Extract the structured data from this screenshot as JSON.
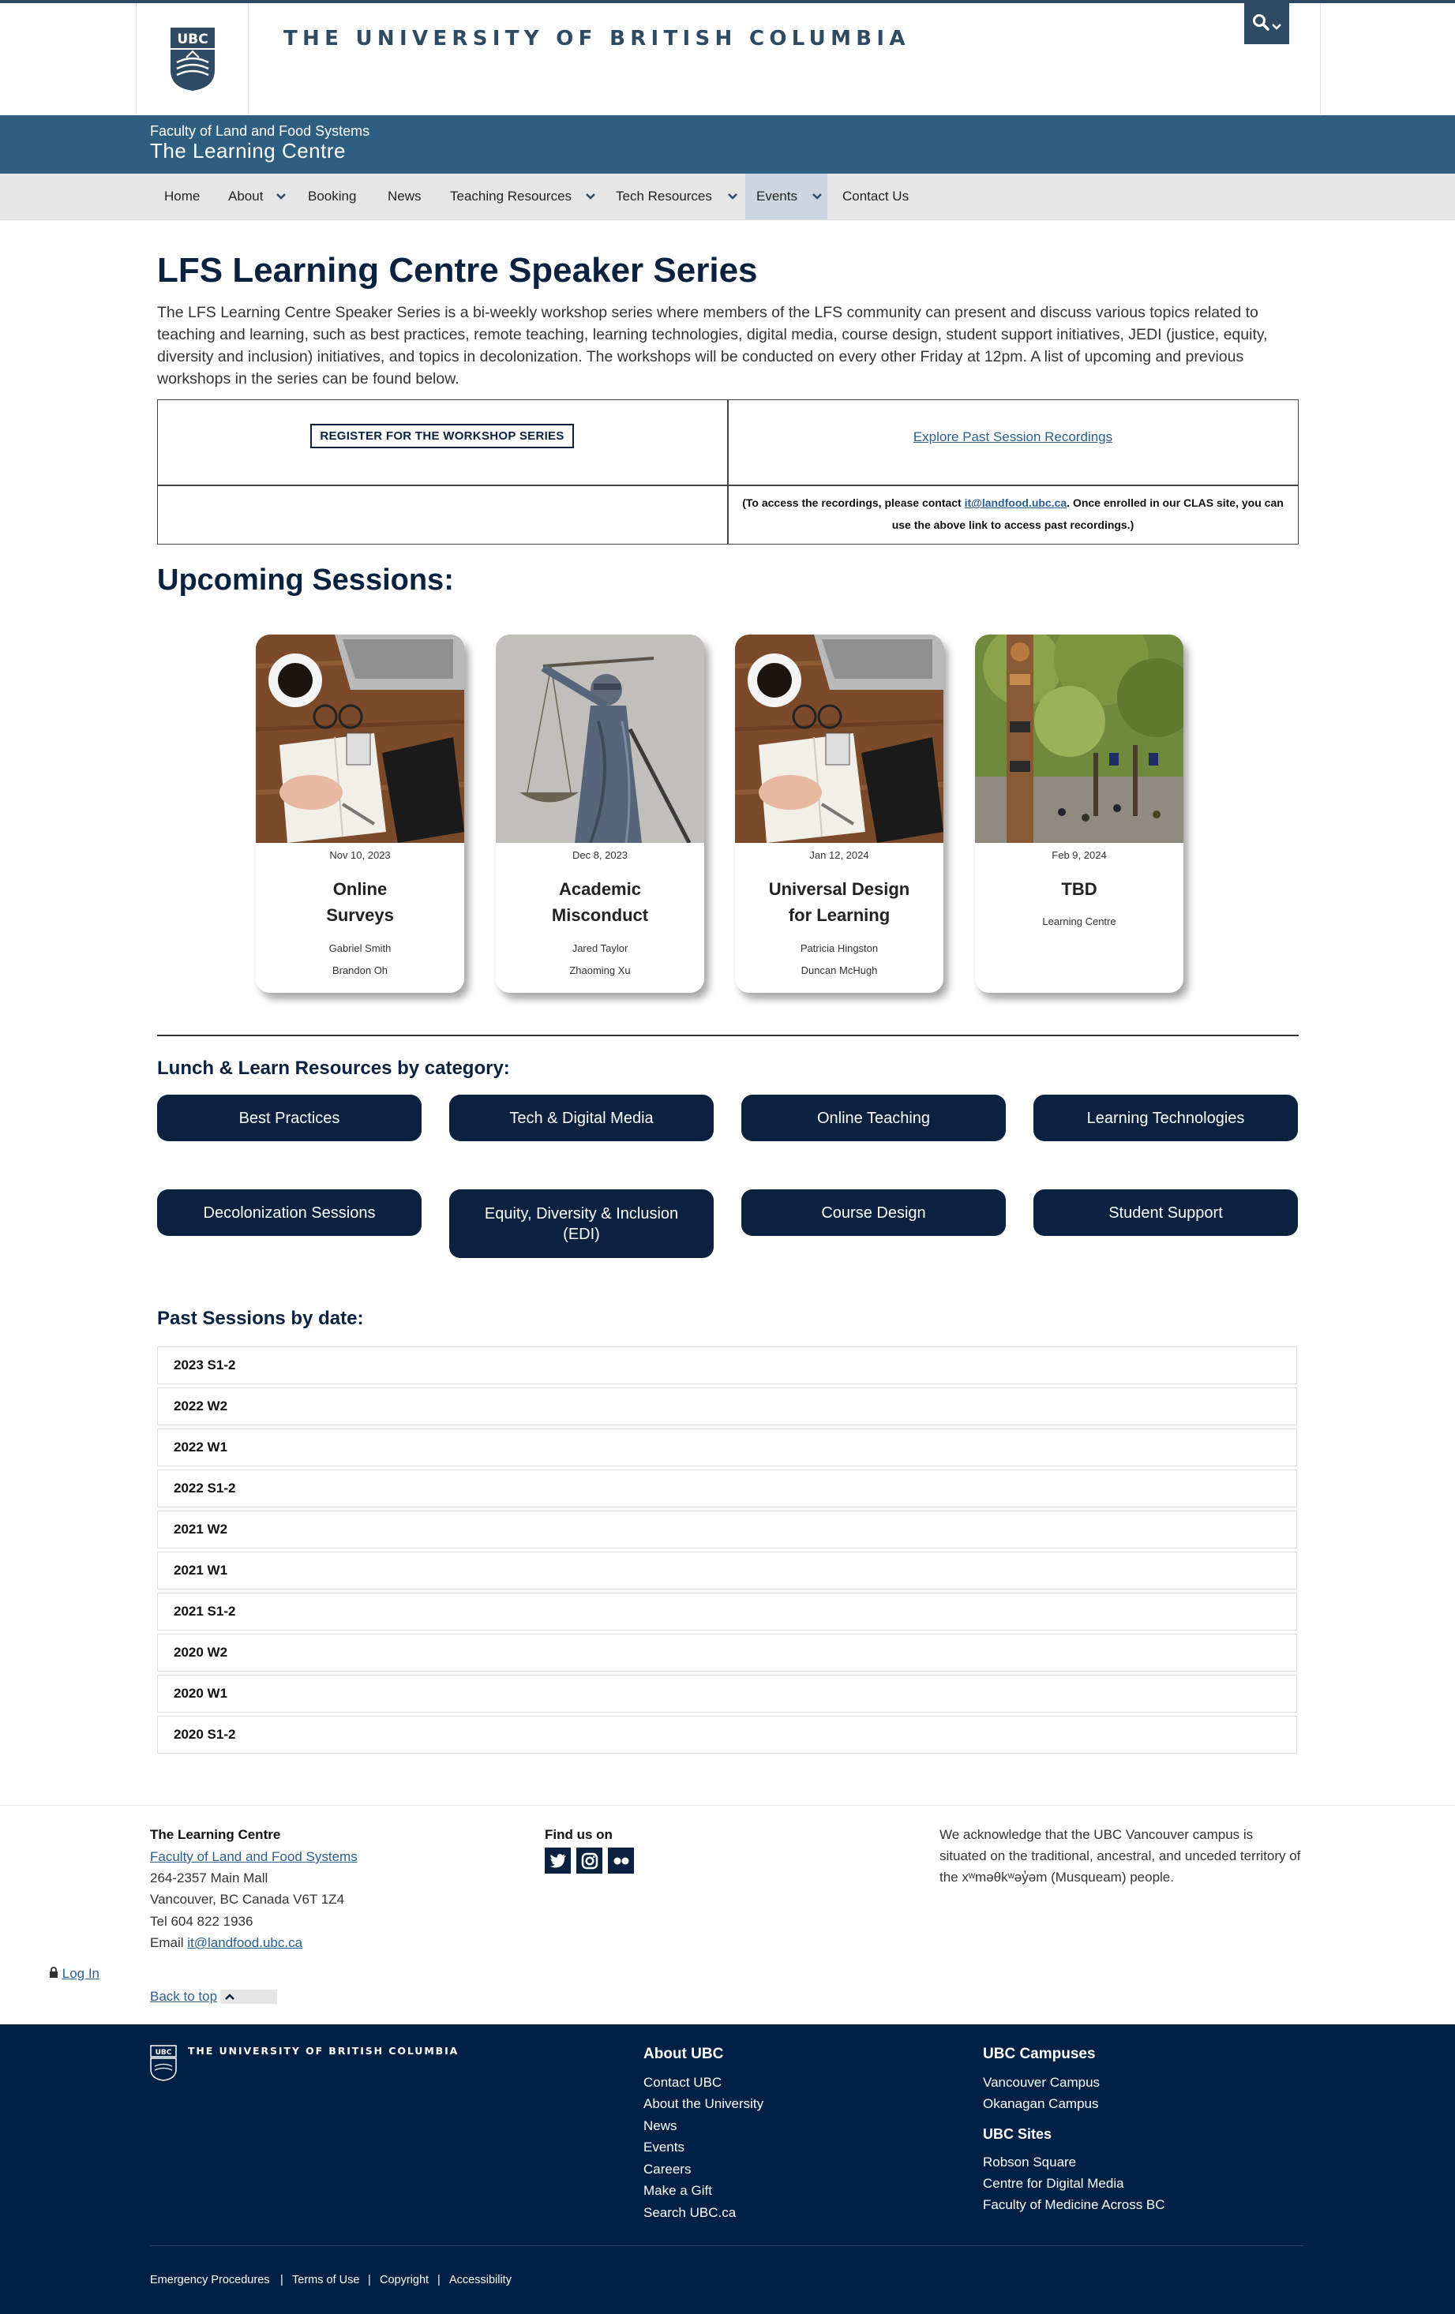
{
  "header": {
    "wordmark": "THE UNIVERSITY OF BRITISH COLUMBIA",
    "crest_text": "UBC",
    "search_icon": "search-icon"
  },
  "unit": {
    "faculty": "Faculty of Land and Food Systems",
    "name": "The Learning Centre"
  },
  "nav": {
    "items": [
      "Home",
      "About",
      "Booking",
      "News",
      "Teaching Resources",
      "Tech Resources",
      "Events",
      "Contact Us"
    ],
    "active": "Events"
  },
  "main": {
    "title": "LFS Learning Centre Speaker Series",
    "intro": "The LFS Learning Centre Speaker Series is a bi-weekly workshop series where members of the LFS community can present and discuss various topics related to teaching and learning, such as best practices, remote teaching, learning technologies, digital media, course design, student support initiatives, JEDI (justice, equity, diversity and inclusion) initiatives, and topics in decolonization. The workshops will be conducted on every other Friday at 12pm. A list of upcoming and previous workshops in the series can be found below.",
    "register_label": "REGISTER FOR THE WORKSHOP SERIES",
    "past_link": "Explore Past Session Recordings",
    "note_prefix": "(To access the recordings, please contact ",
    "note_email": "it@landfood.ubc.ca",
    "note_suffix": ". Once enrolled in our CLAS site, you can use the above link to access past recordings.)"
  },
  "upcoming": {
    "title": "Upcoming Sessions:",
    "cards": [
      {
        "date": "Nov 10, 2023",
        "title": "Online Surveys",
        "people": [
          "Gabriel Smith",
          "Brandon Oh"
        ]
      },
      {
        "date": "Dec 8, 2023",
        "title": "Academic Misconduct",
        "people": [
          "Jared Taylor",
          "Zhaoming Xu"
        ]
      },
      {
        "date": "Jan 12, 2024",
        "title": "Universal Design for Learning",
        "people": [
          "Patricia Hingston",
          "Duncan McHugh"
        ]
      },
      {
        "date": "Feb 9, 2024",
        "title": "TBD",
        "people": [
          "Learning Centre"
        ]
      }
    ]
  },
  "resources": {
    "title": "Lunch & Learn Resources by category:",
    "categories": [
      "Best Practices",
      "Tech & Digital Media",
      "Online Teaching",
      "Learning Technologies",
      "Decolonization Sessions",
      "Equity, Diversity & Inclusion (EDI)",
      "Course Design",
      "Student Support"
    ]
  },
  "past": {
    "title": "Past Sessions by date:",
    "terms": [
      "2023 S1-2",
      "2022 W2",
      "2022 W1",
      "2022 S1-2",
      "2021 W2",
      "2021 W1",
      "2021 S1-2",
      "2020 W2",
      "2020 W1",
      "2020 S1-2"
    ]
  },
  "unit_footer": {
    "name": "The Learning Centre",
    "faculty_link": "Faculty of Land and Food Systems",
    "address1": "264-2357 Main Mall",
    "address2": "Vancouver, BC Canada V6T 1Z4",
    "tel": "Tel 604 822 1936",
    "email_label": "Email ",
    "email": "it@landfood.ubc.ca",
    "find_us": "Find us on",
    "social": [
      "twitter-icon",
      "instagram-icon",
      "flickr-icon"
    ],
    "acknowledgement": "We acknowledge that the UBC Vancouver campus is situated on the traditional, ancestral, and unceded territory of the xʷməθkʷəy̓əm (Musqueam) people.",
    "login": "Log In",
    "back_to_top": "Back to top"
  },
  "ubc_footer": {
    "wordmark": "THE UNIVERSITY OF BRITISH COLUMBIA",
    "about_title": "About UBC",
    "about_links": [
      "Contact UBC",
      "About the University",
      "News",
      "Events",
      "Careers",
      "Make a Gift",
      "Search UBC.ca"
    ],
    "campuses_title": "UBC Campuses",
    "campus_links": [
      "Vancouver Campus",
      "Okanagan Campus"
    ],
    "sites_title": "UBC Sites",
    "site_links": [
      "Robson Square",
      "Centre for Digital Media",
      "Faculty of Medicine Across BC"
    ],
    "legal": [
      "Emergency Procedures",
      "Terms of Use",
      "Copyright",
      "Accessibility"
    ]
  },
  "colors": {
    "ubc_navy": "#002145",
    "unit_blue": "#2f5f80",
    "title_navy": "#0a2240"
  }
}
